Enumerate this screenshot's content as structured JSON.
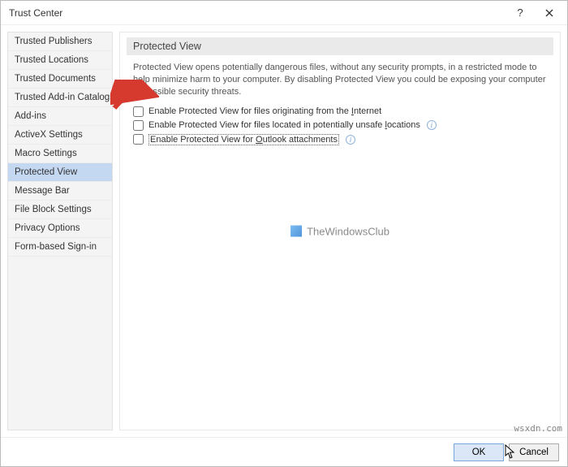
{
  "titlebar": {
    "title": "Trust Center"
  },
  "sidebar": {
    "items": [
      {
        "label": "Trusted Publishers"
      },
      {
        "label": "Trusted Locations"
      },
      {
        "label": "Trusted Documents"
      },
      {
        "label": "Trusted Add-in Catalogs"
      },
      {
        "label": "Add-ins"
      },
      {
        "label": "ActiveX Settings"
      },
      {
        "label": "Macro Settings"
      },
      {
        "label": "Protected View"
      },
      {
        "label": "Message Bar"
      },
      {
        "label": "File Block Settings"
      },
      {
        "label": "Privacy Options"
      },
      {
        "label": "Form-based Sign-in"
      }
    ],
    "selected_index": 7
  },
  "section": {
    "header": "Protected View",
    "description": "Protected View opens potentially dangerous files, without any security prompts, in a restricted mode to help minimize harm to your computer. By disabling Protected View you could be exposing your computer to possible security threats."
  },
  "options": {
    "opt1_pre": "Enable Protected View for files originating from the ",
    "opt1_u": "I",
    "opt1_post": "nternet",
    "opt2_pre": "Enable Protected View for files located in potentially unsafe ",
    "opt2_u": "l",
    "opt2_post": "ocations",
    "opt3_pre": "Enable Protected View for ",
    "opt3_u": "O",
    "opt3_post": "utlook attachments"
  },
  "watermark": {
    "text": "TheWindowsClub"
  },
  "footer": {
    "ok": "OK",
    "cancel": "Cancel"
  },
  "source": "wsxdn.com"
}
